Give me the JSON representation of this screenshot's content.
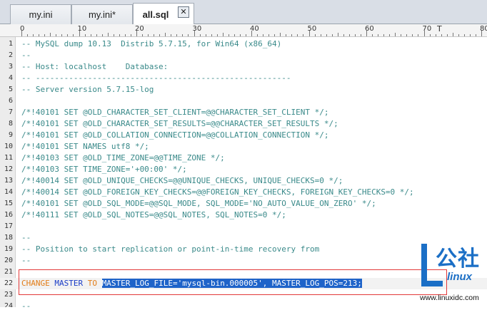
{
  "tabs": [
    {
      "label": "my.ini",
      "active": false
    },
    {
      "label": "my.ini*",
      "active": false
    },
    {
      "label": "all.sql",
      "active": true
    }
  ],
  "close_glyph": "✕",
  "ruler": {
    "labels": [
      "0",
      "10",
      "20",
      "30",
      "40",
      "50",
      "60",
      "70",
      "80"
    ],
    "caret_marker": "T"
  },
  "lines": [
    {
      "n": "1",
      "text": "-- MySQL dump 10.13  Distrib 5.7.15, for Win64 (x86_64)"
    },
    {
      "n": "2",
      "text": "--"
    },
    {
      "n": "3",
      "text": "-- Host: localhost    Database:"
    },
    {
      "n": "4",
      "text": "-- ------------------------------------------------------"
    },
    {
      "n": "5",
      "text": "-- Server version 5.7.15-log"
    },
    {
      "n": "6",
      "text": ""
    },
    {
      "n": "7",
      "text": "/*!40101 SET @OLD_CHARACTER_SET_CLIENT=@@CHARACTER_SET_CLIENT */;"
    },
    {
      "n": "8",
      "text": "/*!40101 SET @OLD_CHARACTER_SET_RESULTS=@@CHARACTER_SET_RESULTS */;"
    },
    {
      "n": "9",
      "text": "/*!40101 SET @OLD_COLLATION_CONNECTION=@@COLLATION_CONNECTION */;"
    },
    {
      "n": "10",
      "text": "/*!40101 SET NAMES utf8 */;"
    },
    {
      "n": "11",
      "text": "/*!40103 SET @OLD_TIME_ZONE=@@TIME_ZONE */;"
    },
    {
      "n": "12",
      "text": "/*!40103 SET TIME_ZONE='+00:00' */;"
    },
    {
      "n": "13",
      "text": "/*!40014 SET @OLD_UNIQUE_CHECKS=@@UNIQUE_CHECKS, UNIQUE_CHECKS=0 */;"
    },
    {
      "n": "14",
      "text": "/*!40014 SET @OLD_FOREIGN_KEY_CHECKS=@@FOREIGN_KEY_CHECKS, FOREIGN_KEY_CHECKS=0 */;"
    },
    {
      "n": "15",
      "text": "/*!40101 SET @OLD_SQL_MODE=@@SQL_MODE, SQL_MODE='NO_AUTO_VALUE_ON_ZERO' */;"
    },
    {
      "n": "16",
      "text": "/*!40111 SET @OLD_SQL_NOTES=@@SQL_NOTES, SQL_NOTES=0 */;"
    },
    {
      "n": "17",
      "text": ""
    },
    {
      "n": "18",
      "text": "--"
    },
    {
      "n": "19",
      "text": "-- Position to start replication or point-in-time recovery from"
    },
    {
      "n": "20",
      "text": "--"
    },
    {
      "n": "21",
      "text": ""
    },
    {
      "n": "22",
      "text": ""
    },
    {
      "n": "23",
      "text": ""
    },
    {
      "n": "24",
      "text": "--"
    }
  ],
  "highlight_line": {
    "kw1": "CHANGE",
    "kw2": "MASTER",
    "kw3": "TO",
    "selected": "MASTER_LOG_FILE='mysql-bin.000005', MASTER_LOG_POS=21",
    "selected_tail": "3;"
  },
  "watermark": {
    "big_letter": "L",
    "chars": "公社",
    "sub": "linux",
    "url": "www.linuxidc.com"
  },
  "colors": {
    "comment": "#3a8a8a",
    "keyword_orange": "#e27d18",
    "keyword_blue": "#1a3cc7",
    "selection": "#1e63c9",
    "annotation_box": "#e33a3a",
    "logo_blue": "#1b6fc6"
  }
}
